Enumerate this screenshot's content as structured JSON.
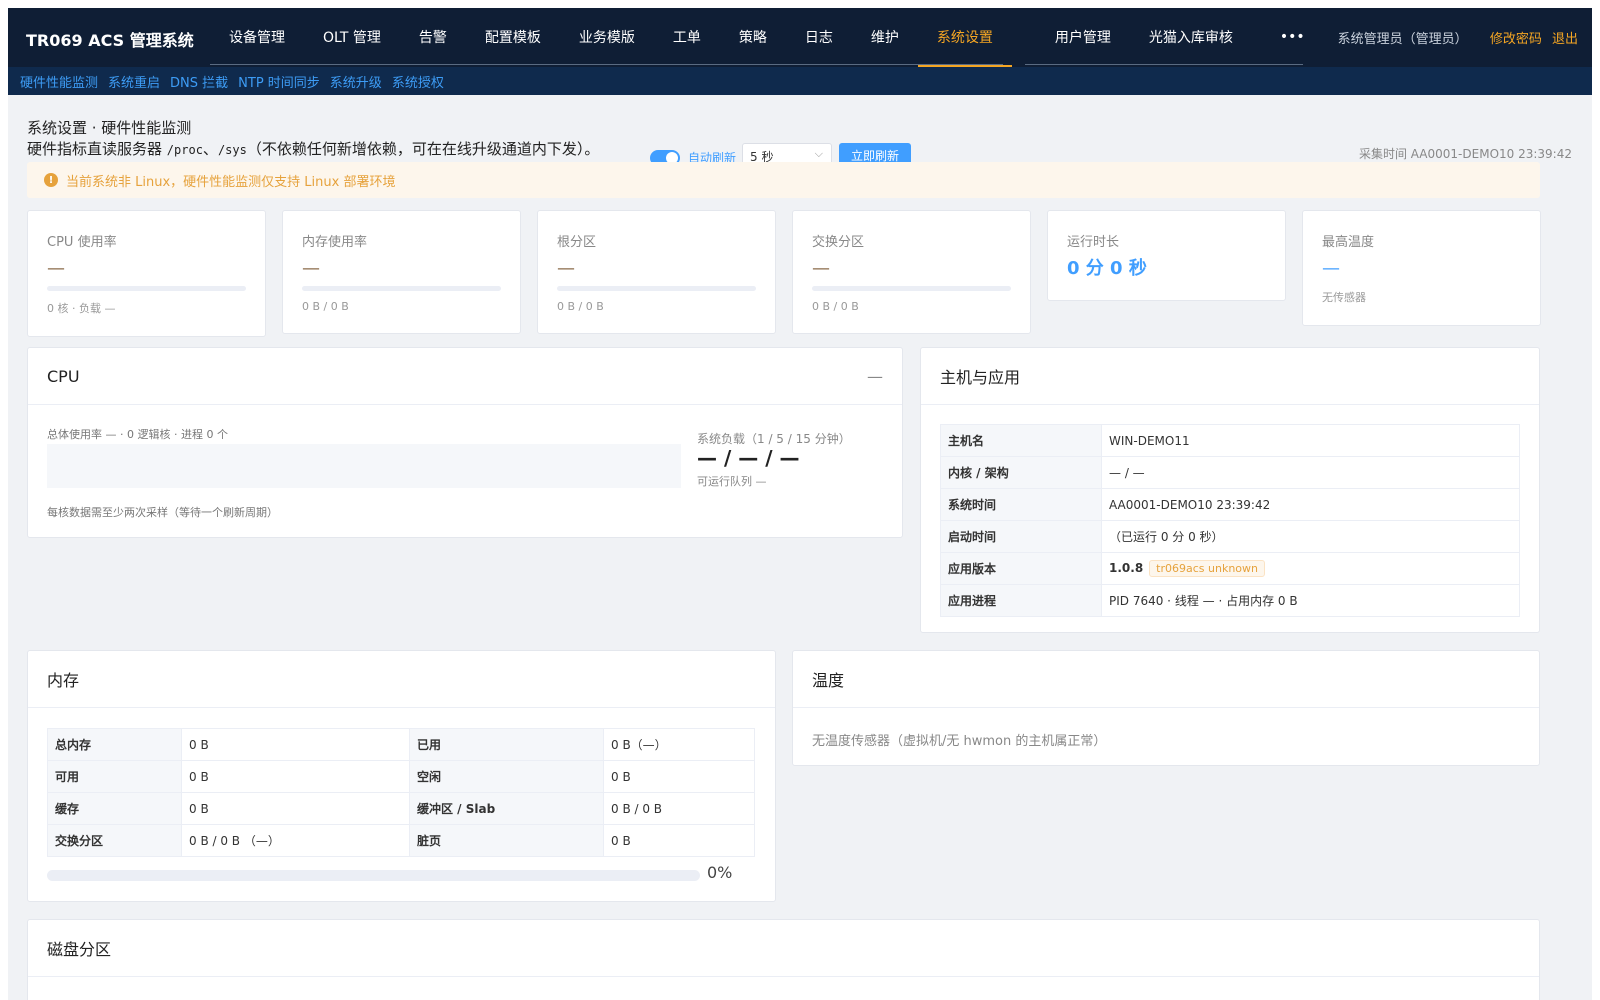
{
  "brand": "TR069 ACS 管理系统",
  "nav": [
    "设备管理",
    "OLT 管理",
    "告警",
    "配置模板",
    "业务模版",
    "工单",
    "策略",
    "日志",
    "维护",
    "系统设置"
  ],
  "nav2": [
    "用户管理",
    "光猫入库审核"
  ],
  "nav_more": "•••",
  "user": {
    "role": "系统管理员（管理员）",
    "change_password": "修改密码",
    "logout": "退出"
  },
  "subnav": [
    "硬件性能监测",
    "系统重启",
    "DNS 拦截",
    "NTP 时间同步",
    "系统升级",
    "系统授权"
  ],
  "page": {
    "title": "系统设置 · 硬件性能监测",
    "subtitle_a": "硬件指标直读服务器",
    "path1": "/proc",
    "sep": "、",
    "path2": "/sys",
    "subtitle_b": "（不依赖任何新增依赖，可在在线升级通道内下发）。",
    "auto_refresh": "自动刷新",
    "interval": "5 秒",
    "refresh_now": "立即刷新",
    "collect_time": "采集时间 AA0001-DEMO10 23:39:42"
  },
  "alert": "当前系统非 Linux，硬件性能监测仅支持 Linux 部署环境",
  "stats": {
    "cpu": {
      "label": "CPU 使用率",
      "value": "—",
      "sub": "0 核 · 负载 —"
    },
    "mem": {
      "label": "内存使用率",
      "value": "—",
      "sub": "0 B / 0 B"
    },
    "root": {
      "label": "根分区",
      "value": "—",
      "sub": "0 B / 0 B"
    },
    "swap": {
      "label": "交换分区",
      "value": "—",
      "sub": "0 B / 0 B"
    },
    "uptime": {
      "label": "运行时长",
      "value": "0 分 0 秒"
    },
    "temp": {
      "label": "最高温度",
      "value": "—",
      "sub": "无传感器"
    }
  },
  "cpu_card": {
    "title": "CPU",
    "collapse": "—",
    "total": "总体使用率 — · 0 逻辑核 · 进程 0 个",
    "note": "每核数据需至少两次采样（等待一个刷新周期）",
    "load_label": "系统负载（1 / 5 / 15 分钟）",
    "load_value": "— / — / —",
    "run_queue": "可运行队列 —"
  },
  "host_card": {
    "title": "主机与应用",
    "rows": [
      {
        "k": "主机名",
        "v": "WIN-DEMO11"
      },
      {
        "k": "内核 / 架构",
        "v": "— / —"
      },
      {
        "k": "系统时间",
        "v": "AA0001-DEMO10 23:39:42"
      },
      {
        "k": "启动时间",
        "v": "（已运行 0 分 0 秒）"
      },
      {
        "k": "应用版本",
        "v": "1.0.8",
        "tag": "tr069acs unknown"
      },
      {
        "k": "应用进程",
        "v": "PID 7640 · 线程 — · 占用内存 0 B"
      }
    ]
  },
  "mem_card": {
    "title": "内存",
    "rows": [
      {
        "k1": "总内存",
        "v1": "0 B",
        "k2": "已用",
        "v2": "0 B（—）"
      },
      {
        "k1": "可用",
        "v1": "0 B",
        "k2": "空闲",
        "v2": "0 B"
      },
      {
        "k1": "缓存",
        "v1": "0 B",
        "k2": "缓冲区 / Slab",
        "v2": "0 B / 0 B"
      },
      {
        "k1": "交换分区",
        "v1": "0 B / 0 B （—）",
        "k2": "脏页",
        "v2": "0 B"
      }
    ],
    "usage_percent": 0,
    "usage_label": "0%"
  },
  "temp_card": {
    "title": "温度",
    "text": "无温度传感器（虚拟机/无 hwmon 的主机属正常）"
  },
  "disk_card": {
    "title": "磁盘分区"
  },
  "colors": {
    "accent": "#409eff",
    "nav_active": "#f5a623",
    "warning": "#e6a23c",
    "topbar": "#0f1e35"
  }
}
